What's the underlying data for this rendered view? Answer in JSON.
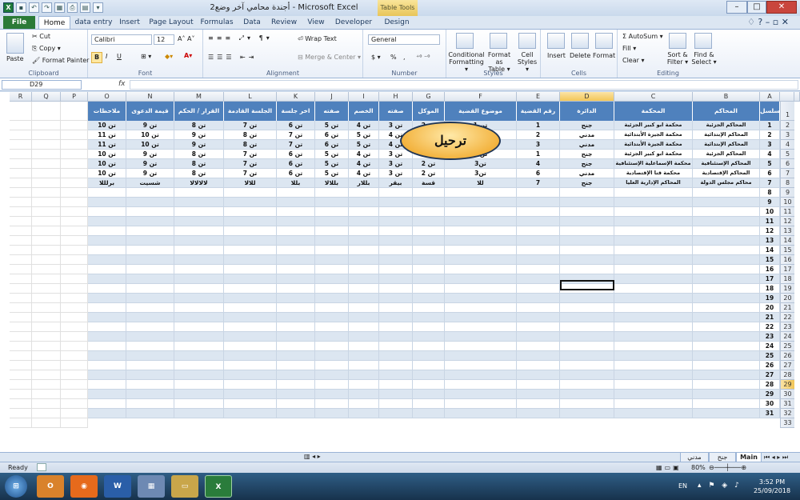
{
  "window": {
    "title": "أجندة محامي آخر وضع2 - Microsoft Excel",
    "table_tools": "Table Tools",
    "min": "–",
    "max": "□",
    "close": "✕"
  },
  "tabs": [
    "File",
    "Home",
    "data entry",
    "Insert",
    "Page Layout",
    "Formulas",
    "Data",
    "Review",
    "View",
    "Developer",
    "Design"
  ],
  "ribbon": {
    "clipboard": {
      "paste": "Paste",
      "cut": "Cut",
      "copy": "Copy ▾",
      "format_painter": "Format Painter",
      "label": "Clipboard"
    },
    "font": {
      "name": "Calibri",
      "size": "12",
      "label": "Font",
      "bold": "B",
      "italic": "I",
      "underline": "U"
    },
    "alignment": {
      "wrap": "Wrap Text",
      "merge": "Merge & Center ▾",
      "label": "Alignment"
    },
    "number": {
      "format": "General",
      "currency": "$ ▾",
      "percent": "%",
      "comma": ",",
      "label": "Number"
    },
    "styles": {
      "conditional": "Conditional Formatting ▾",
      "format_table": "Format as Table ▾",
      "cell_styles": "Cell Styles ▾",
      "label": "Styles"
    },
    "cells": {
      "insert": "Insert",
      "delete": "Delete",
      "format": "Format",
      "label": "Cells"
    },
    "editing": {
      "autosum": "Σ AutoSum ▾",
      "fill": "Fill ▾",
      "clear": "Clear ▾",
      "sort": "Sort & Filter ▾",
      "find": "Find & Select ▾",
      "label": "Editing"
    }
  },
  "formula_bar": {
    "name_box": "D29",
    "fx": "fx",
    "value": ""
  },
  "columns": [
    "R",
    "Q",
    "P",
    "O",
    "N",
    "M",
    "L",
    "K",
    "J",
    "I",
    "H",
    "G",
    "F",
    "E",
    "D",
    "C",
    "B",
    "A"
  ],
  "headers": [
    "ملاحظات",
    "قيمة الدعوى",
    "القرار / الحكم",
    "الجلسة القادمة",
    "اخر جلسة",
    "صفته",
    "الخصم",
    "صفته",
    "الموكل",
    "موضوع القضية",
    "رقم القضية",
    "الدائرة",
    "المحكمة",
    "المحاكم",
    "مسلسل"
  ],
  "rows": [
    [
      "تن 10",
      "تن 9",
      "تن 8",
      "تن 7",
      "تن 6",
      "تن 5",
      "تن 4",
      "تن 3",
      "تن 2",
      "تن 1",
      "1",
      "جنح",
      "محكمة ابو كبير الجزئية",
      "المحاكم الجزئية",
      "1"
    ],
    [
      "تن 11",
      "تن 10",
      "تن 9",
      "تن 8",
      "تن 7",
      "تن 6",
      "تن 5",
      "تن 4",
      "تن 3",
      "تن 2",
      "2",
      "مدني",
      "محكمة الجيزة الأبتدائية",
      "المحاكم الإبتدائية",
      "2"
    ],
    [
      "تن 11",
      "تن 10",
      "تن 9",
      "تن 8",
      "تن 7",
      "تن 6",
      "تن 5",
      "تن 4",
      "تن 3",
      "تن 2",
      "3",
      "مدني",
      "محكمة الجيزة الأبتدائية",
      "المحاكم الإبتدائية",
      "3"
    ],
    [
      "تن 10",
      "تن 9",
      "تن 8",
      "تن 7",
      "تن 6",
      "تن 5",
      "تن 4",
      "تن 3",
      "تن 2",
      "تن 1",
      "1",
      "جنح",
      "محكمة ابو كبير الجزئية",
      "المحاكم الجزئية",
      "4"
    ],
    [
      "تن 10",
      "تن 9",
      "تن 8",
      "تن 7",
      "تن 6",
      "تن 5",
      "تن 4",
      "تن 3",
      "تن 2",
      "تن3",
      "4",
      "جنح",
      "محكمة الإسماعلية الإستئنافية",
      "المحاكم الإستئنافية",
      "5"
    ],
    [
      "تن 10",
      "تن 9",
      "تن 8",
      "تن 7",
      "تن 6",
      "تن 5",
      "تن 4",
      "تن 3",
      "تن 2",
      "تن3",
      "6",
      "مدني",
      "محكمة قنا الإقتصادية",
      "المحاكم الإقتصادية",
      "6"
    ],
    [
      "برلللا",
      "شسيت",
      "لالالالا",
      "للالا",
      "بللا",
      "بللالا",
      "بللار",
      "بيقر",
      "قسة",
      "للا",
      "7",
      "جنح",
      "المحاكم الإدارية العليا",
      "محاكم مجلس الدولة",
      "7"
    ]
  ],
  "serials_after": [
    "8",
    "9",
    "10",
    "11",
    "12",
    "13",
    "14",
    "15",
    "16",
    "17",
    "18",
    "19",
    "20",
    "21",
    "22",
    "23",
    "24",
    "25",
    "26",
    "27",
    "28",
    "29",
    "30",
    "31"
  ],
  "row_numbers": [
    "1",
    "2",
    "3",
    "4",
    "5",
    "6",
    "7",
    "8",
    "9",
    "10",
    "11",
    "12",
    "13",
    "14",
    "15",
    "16",
    "17",
    "18",
    "19",
    "20",
    "21",
    "22",
    "23",
    "24",
    "25",
    "26",
    "27",
    "28",
    "29",
    "30",
    "31",
    "32",
    "33"
  ],
  "button_label": "ترحيل",
  "sheets": {
    "main": "Main",
    "s2": "جنح",
    "s3": "مدني"
  },
  "status": {
    "ready": "Ready",
    "zoom": "80%"
  },
  "taskbar": {
    "lang": "EN",
    "time": "3:52 PM",
    "date": "25/09/2018"
  }
}
